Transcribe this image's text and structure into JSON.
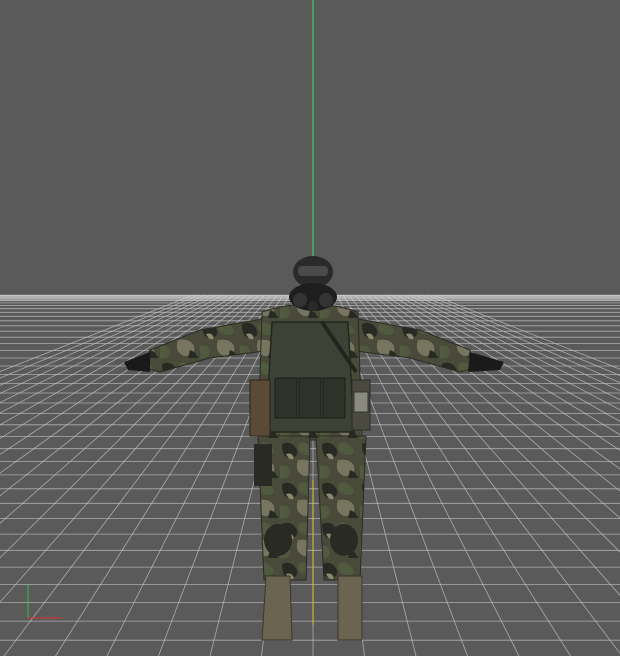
{
  "viewport": {
    "background": "#5a5a5a",
    "grid_color": "#c8c8c8",
    "grid_major_color": "#e6e6e6",
    "axis_y_color": "#3fe05a",
    "axis_z_color": "#d8c83a",
    "gizmo": {
      "x_color": "#e03030",
      "y_color": "#30c040"
    }
  },
  "model": {
    "camo_base": "#4a4a3a",
    "camo_dark": "#262a22",
    "camo_green": "#4f5a3e",
    "camo_light": "#77745f",
    "vest": "#3c4236",
    "mask": "#1e1e1e",
    "boots": "#6b6450",
    "gloves": "#1a1a1a"
  }
}
